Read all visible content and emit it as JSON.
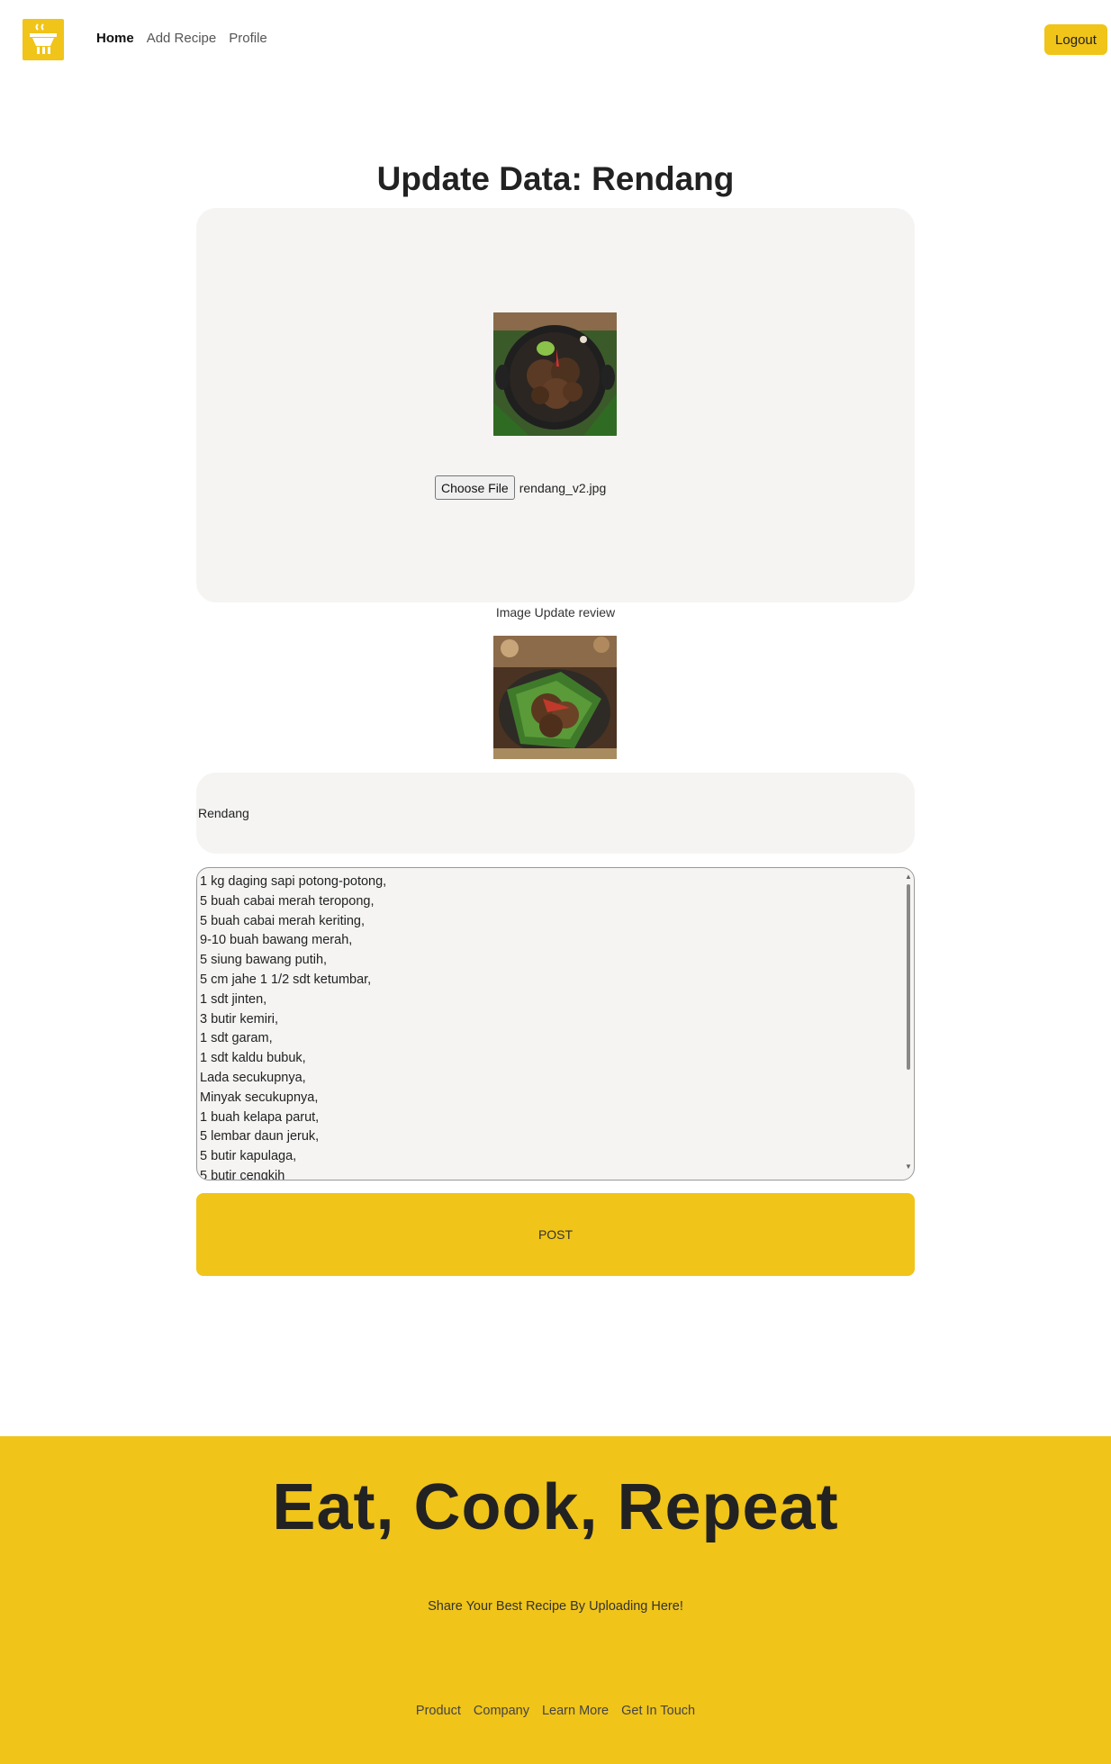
{
  "navbar": {
    "logo_icon": "cooking-pot-icon",
    "links": [
      {
        "label": "Home",
        "active": true
      },
      {
        "label": "Add Recipe",
        "active": false
      },
      {
        "label": "Profile",
        "active": false
      }
    ],
    "logout_label": "Logout"
  },
  "page": {
    "title": "Update Data: Rendang"
  },
  "upload": {
    "current_image_alt": "Rendang",
    "choose_file_label": "Choose File",
    "file_name": "rendang_v2.jpg"
  },
  "preview": {
    "caption": "Image Update review",
    "image_alt": "Rendang preview"
  },
  "form": {
    "recipe_title": "Rendang",
    "ingredients": [
      "1 kg daging sapi potong-potong,",
      "5 buah cabai merah teropong,",
      "5 buah cabai merah keriting,",
      "9-10 buah bawang merah,",
      "5 siung bawang putih,",
      "5 cm jahe 1 1/2 sdt ketumbar,",
      "1 sdt jinten,",
      "3 butir kemiri,",
      "1 sdt garam,",
      "1 sdt kaldu bubuk,",
      "Lada secukupnya,",
      "Minyak secukupnya,",
      "1 buah kelapa parut,",
      "5 lembar daun jeruk,",
      "5 butir kapulaga,",
      "5 butir cengkih"
    ],
    "post_label": "POST"
  },
  "footer": {
    "heading": "Eat, Cook, Repeat",
    "subtitle": "Share Your Best Recipe By Uploading Here!",
    "links": [
      "Product",
      "Company",
      "Learn More",
      "Get In Touch"
    ]
  },
  "colors": {
    "accent": "#f0c419",
    "panel": "#f5f4f3"
  }
}
